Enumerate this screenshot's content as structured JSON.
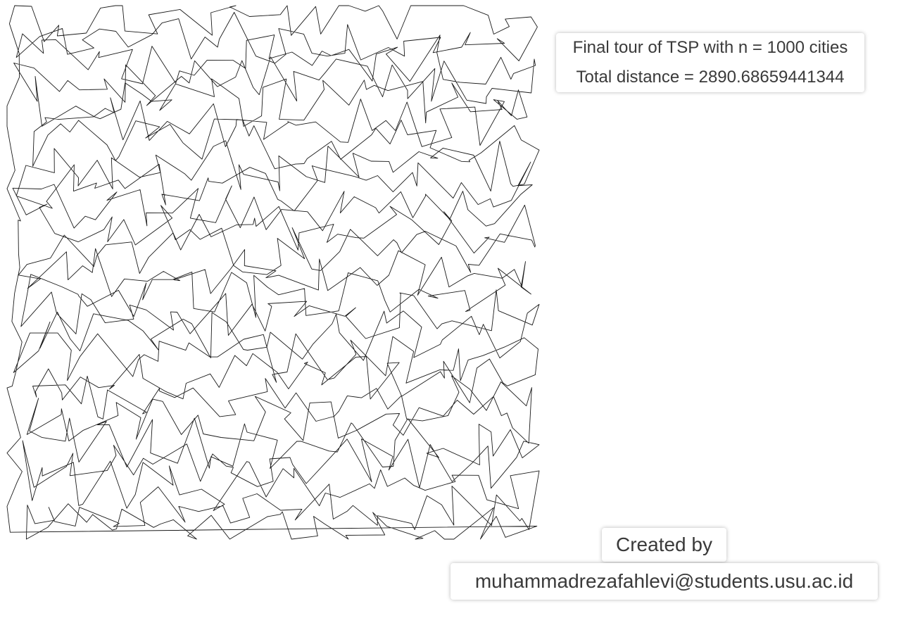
{
  "info": {
    "title_line": "Final tour of TSP with n = 1000 cities",
    "distance_line": "Total distance = 2890.68659441344"
  },
  "credits": {
    "title": "Created by",
    "email": "muhammadrezafahlevi@students.usu.ac.id"
  },
  "tour": {
    "city_count": 1000,
    "total_distance": 2890.68659441344,
    "stroke_color": "#1a1a1a",
    "background_color": "#ffffff"
  }
}
